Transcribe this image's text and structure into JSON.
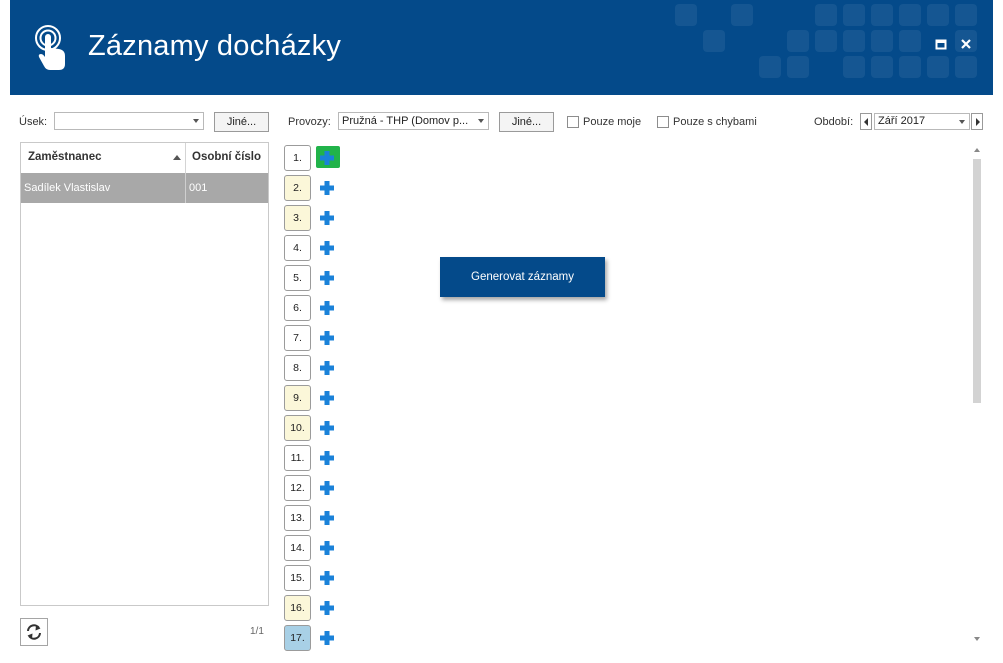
{
  "app": {
    "title": "Záznamy docházky"
  },
  "colors": {
    "header_bg": "#044a8a",
    "selected_row": "#a8a8a8",
    "weekend_day": "#fbf7d9",
    "today_day": "#a8d0e6",
    "active_add": "#21b34a",
    "add_icon": "#1a82d9"
  },
  "window": {
    "maximize_icon": "maximize-icon",
    "close_icon": "close-icon"
  },
  "toolbar": {
    "usek_label": "Úsek:",
    "usek_value": "",
    "usek_other_button": "Jiné...",
    "provozy_label": "Provozy:",
    "provozy_value": "Pružná - THP (Domov p...",
    "provozy_other_button": "Jiné...",
    "only_mine_label": "Pouze moje",
    "only_mine_checked": false,
    "only_errors_label": "Pouze s chybami",
    "only_errors_checked": false,
    "period_label": "Období:",
    "period_value": "Září 2017"
  },
  "employees": {
    "columns": [
      "Zaměstnanec",
      "Osobní číslo"
    ],
    "sort": "ascending",
    "rows": [
      {
        "name": "Sadílek Vlastislav",
        "number": "001",
        "selected": true
      }
    ],
    "pager": "1/1"
  },
  "days": [
    {
      "label": "1.",
      "type": "normal"
    },
    {
      "label": "2.",
      "type": "weekend"
    },
    {
      "label": "3.",
      "type": "weekend"
    },
    {
      "label": "4.",
      "type": "normal"
    },
    {
      "label": "5.",
      "type": "normal"
    },
    {
      "label": "6.",
      "type": "normal"
    },
    {
      "label": "7.",
      "type": "normal"
    },
    {
      "label": "8.",
      "type": "normal"
    },
    {
      "label": "9.",
      "type": "weekend"
    },
    {
      "label": "10.",
      "type": "weekend"
    },
    {
      "label": "11.",
      "type": "normal"
    },
    {
      "label": "12.",
      "type": "normal"
    },
    {
      "label": "13.",
      "type": "normal"
    },
    {
      "label": "14.",
      "type": "normal"
    },
    {
      "label": "15.",
      "type": "normal"
    },
    {
      "label": "16.",
      "type": "weekend"
    },
    {
      "label": "17.",
      "type": "today"
    }
  ],
  "main": {
    "generate_button": "Generovat záznamy"
  }
}
